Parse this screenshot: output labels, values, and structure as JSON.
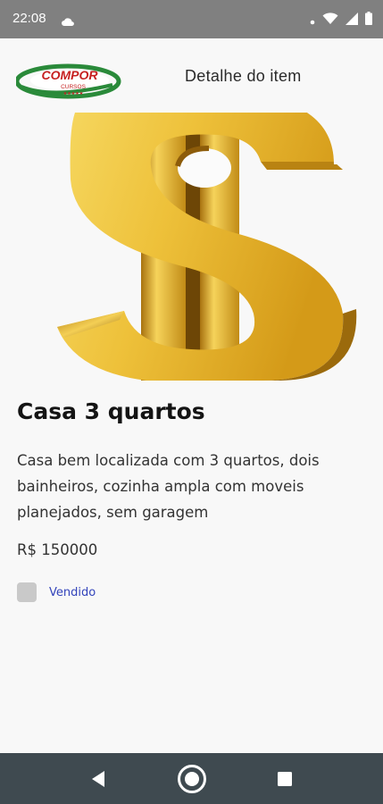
{
  "status_bar": {
    "time": "22:08",
    "icons": [
      "cloud-icon",
      "dot-icon",
      "wifi-icon",
      "signal-icon",
      "battery-icon"
    ]
  },
  "header": {
    "logo_text": "COMPOR",
    "logo_subtext": "CURSOS",
    "title": "Detalhe do item"
  },
  "item": {
    "title": "Casa 3 quartos",
    "description": "Casa bem localizada com 3 quartos, dois bainheiros, cozinha ampla com moveis planejados, sem garagem",
    "price": "R$ 150000",
    "sold_label": "Vendido",
    "sold_checked": false
  },
  "nav_bar": {
    "buttons": [
      "back-icon",
      "home-icon",
      "recents-icon"
    ]
  },
  "colors": {
    "status_bar": "#808080",
    "background": "#f8f8f8",
    "nav_bar": "#3f4a50",
    "accent": "#3344bb",
    "gold": "#e9b92c"
  }
}
